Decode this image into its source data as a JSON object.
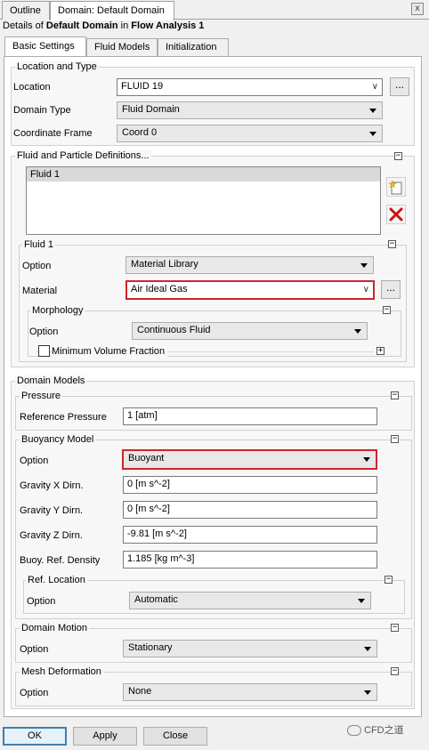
{
  "top_tabs": [
    "Outline",
    "Domain: Default Domain"
  ],
  "close_label": "x",
  "details": {
    "prefix": "Details of ",
    "object": "Default Domain",
    "middle": " in ",
    "analysis": "Flow Analysis 1"
  },
  "sub_tabs": [
    "Basic Settings",
    "Fluid Models",
    "Initialization"
  ],
  "location_type": {
    "title": "Location and Type",
    "location_label": "Location",
    "location_value": "FLUID 19",
    "domain_type_label": "Domain Type",
    "domain_type_value": "Fluid Domain",
    "coord_label": "Coordinate Frame",
    "coord_value": "Coord 0",
    "dots": "..."
  },
  "fluid_defs": {
    "title": "Fluid and Particle Definitions...",
    "items": [
      "Fluid 1"
    ],
    "fluid1": {
      "title": "Fluid 1",
      "option_label": "Option",
      "option_value": "Material Library",
      "material_label": "Material",
      "material_value": "Air Ideal Gas",
      "morph_title": "Morphology",
      "morph_option_label": "Option",
      "morph_option_value": "Continuous Fluid",
      "min_vol_label": "Minimum Volume Fraction"
    }
  },
  "domain_models": {
    "title": "Domain Models",
    "pressure_title": "Pressure",
    "ref_pressure_label": "Reference Pressure",
    "ref_pressure_value": "1 [atm]",
    "buoy_title": "Buoyancy Model",
    "buoy_option_label": "Option",
    "buoy_option_value": "Buoyant",
    "gx_label": "Gravity X Dirn.",
    "gx_value": "0 [m s^-2]",
    "gy_label": "Gravity Y Dirn.",
    "gy_value": "0 [m s^-2]",
    "gz_label": "Gravity Z Dirn.",
    "gz_value": "-9.81 [m s^-2]",
    "density_label": "Buoy. Ref. Density",
    "density_value": "1.185 [kg m^-3]",
    "ref_loc_title": "Ref. Location",
    "ref_loc_option_label": "Option",
    "ref_loc_option_value": "Automatic",
    "motion_title": "Domain Motion",
    "motion_option_label": "Option",
    "motion_option_value": "Stationary",
    "mesh_title": "Mesh Deformation",
    "mesh_option_label": "Option",
    "mesh_option_value": "None"
  },
  "buttons": {
    "ok": "OK",
    "apply": "Apply",
    "close": "Close"
  },
  "watermark": "CFD之道",
  "colors": {
    "highlight": "#d0242c",
    "default_button_border": "#3c7fb1",
    "delete_icon": "#cc1111"
  }
}
